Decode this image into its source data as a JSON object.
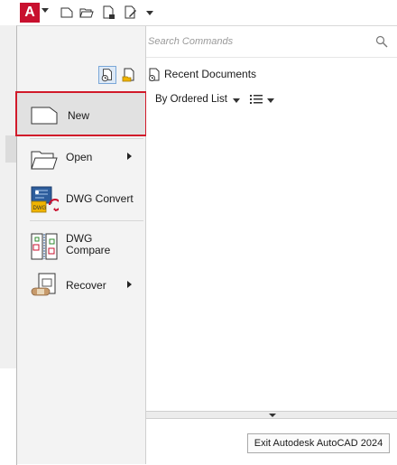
{
  "app": {
    "logo_letter": "A",
    "brand_color": "#c8102e"
  },
  "quick_access": {
    "icons": [
      "new-file-icon",
      "open-folder-icon",
      "save-icon",
      "save-as-icon"
    ]
  },
  "search": {
    "placeholder": "Search Commands"
  },
  "left_menu": {
    "items": [
      {
        "label": "New"
      },
      {
        "label": "Open"
      },
      {
        "label": "DWG Convert"
      },
      {
        "label_line1": "DWG",
        "label_line2": "Compare"
      },
      {
        "label": "Recover"
      }
    ]
  },
  "recent": {
    "title": "Recent Documents",
    "order_label": "By Ordered List"
  },
  "exit": {
    "label": "Exit Autodesk AutoCAD 2024"
  },
  "colors": {
    "highlight_border": "#d11a2a",
    "accent_blue": "#7aa7d8"
  }
}
